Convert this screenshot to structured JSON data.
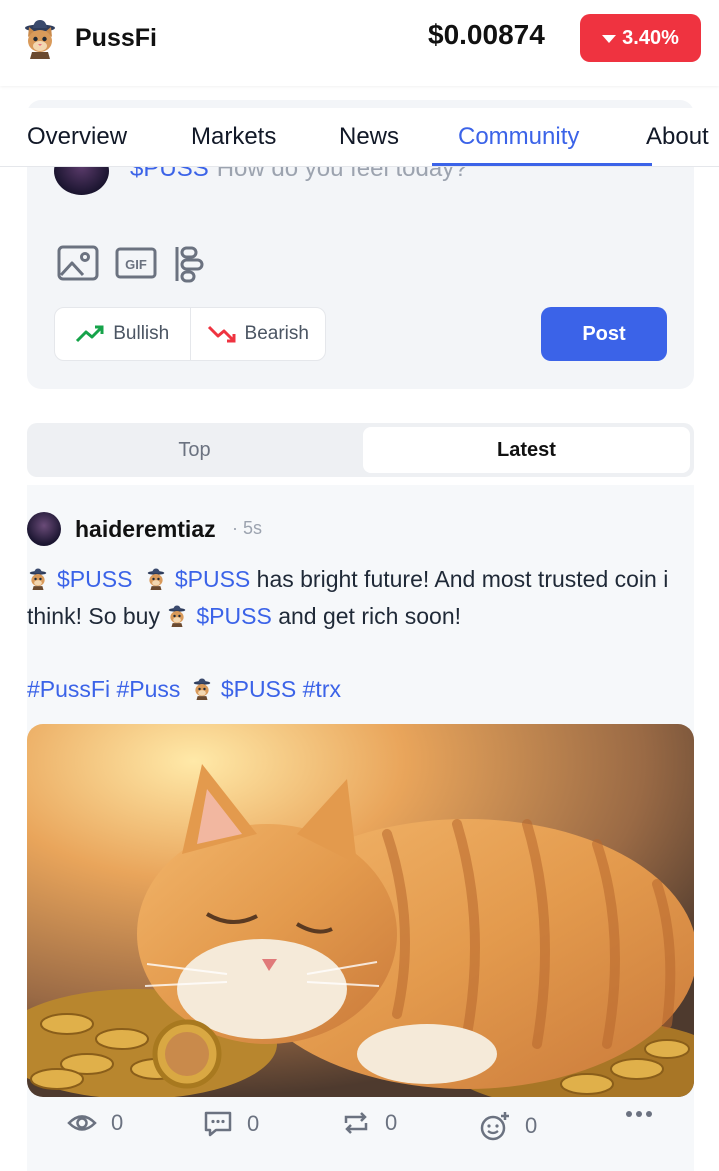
{
  "header": {
    "brand": "PussFi",
    "price": "$0.00874",
    "change": "3.40%",
    "change_color": "#ef3340"
  },
  "tabs": [
    {
      "label": "Overview"
    },
    {
      "label": "Markets"
    },
    {
      "label": "News"
    },
    {
      "label": "Community",
      "active": true
    },
    {
      "label": "About"
    }
  ],
  "composer": {
    "ticker": "$PUSS",
    "placeholder": "How do you feel today?",
    "tools": [
      "image-icon",
      "gif-icon",
      "poll-icon"
    ],
    "bullish_label": "Bullish",
    "bearish_label": "Bearish",
    "post_label": "Post"
  },
  "sort": {
    "top_label": "Top",
    "latest_label": "Latest",
    "selected": "Latest"
  },
  "post": {
    "username": "haideremtiaz",
    "time": "· 5s",
    "ticker": "$PUSS",
    "text_a": "has bright future! And most trusted coin i think! So buy",
    "text_b": "and get rich soon!",
    "tag1": "#PussFi",
    "tag2": "#Puss",
    "tag3": "#trx",
    "views": "0",
    "comments": "0",
    "reposts": "0",
    "reactions": "0"
  },
  "colors": {
    "accent": "#3b63e8",
    "bullish": "#16a34a",
    "bearish": "#ef3340"
  }
}
